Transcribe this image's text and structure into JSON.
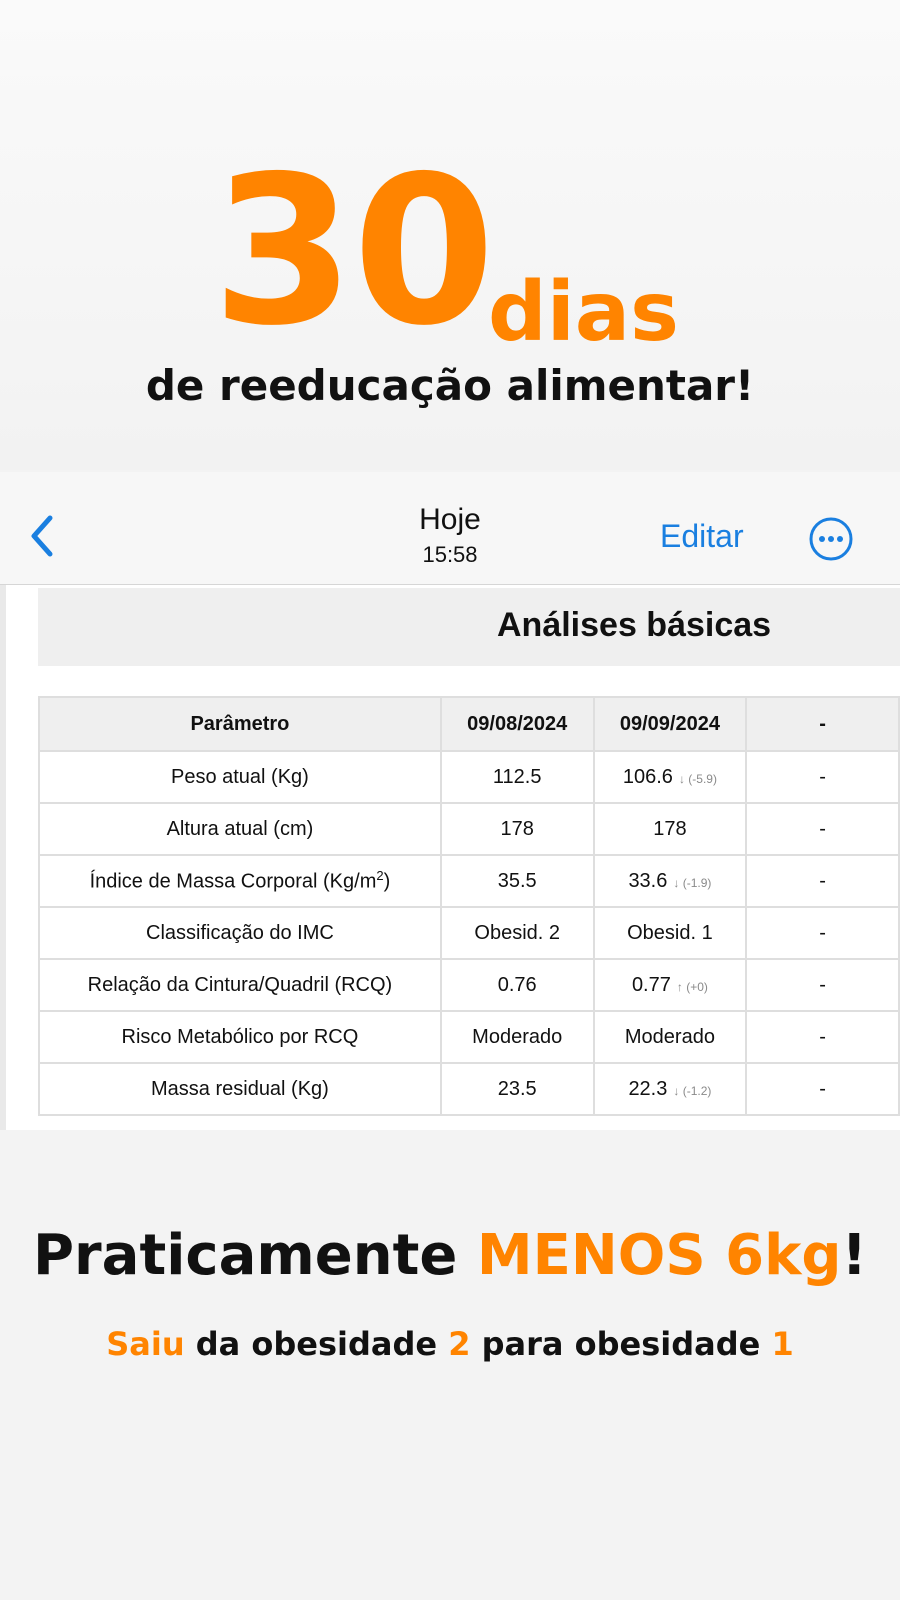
{
  "headline": {
    "number": "30",
    "unit": "dias",
    "subtitle": "de reeducação alimentar!"
  },
  "navbar": {
    "title": "Hoje",
    "time": "15:58",
    "edit_label": "Editar",
    "back_icon": "chevron-left-icon",
    "more_icon": "ellipsis-circle-icon"
  },
  "section": {
    "title": "Análises básicas"
  },
  "table": {
    "headers": [
      "Parâmetro",
      "09/08/2024",
      "09/09/2024",
      "-"
    ],
    "rows": [
      {
        "param": "Peso atual (Kg)",
        "v1": "112.5",
        "v2": "106.6",
        "d2": "↓ (-5.9)",
        "v3": "-"
      },
      {
        "param": "Altura atual (cm)",
        "v1": "178",
        "v2": "178",
        "d2": "",
        "v3": "-"
      },
      {
        "param": "Índice de Massa Corporal (Kg/m",
        "sup": "2",
        "param_end": ")",
        "v1": "35.5",
        "v2": "33.6",
        "d2": "↓ (-1.9)",
        "v3": "-"
      },
      {
        "param": "Classificação do IMC",
        "v1": "Obesid. 2",
        "v2": "Obesid. 1",
        "d2": "",
        "v3": "-"
      },
      {
        "param": "Relação da Cintura/Quadril (RCQ)",
        "v1": "0.76",
        "v2": "0.77",
        "d2": "↑ (+0)",
        "v3": "-"
      },
      {
        "param": "Risco Metabólico por RCQ",
        "v1": "Moderado",
        "v2": "Moderado",
        "d2": "",
        "v3": "-"
      },
      {
        "param": "Massa residual (Kg)",
        "v1": "23.5",
        "v2": "22.3",
        "d2": "↓ (-1.2)",
        "v3": "-"
      }
    ]
  },
  "footer": {
    "line1_a": "Praticamente ",
    "line1_b": "MENOS 6kg",
    "line1_c": "!",
    "line2_a": "Saiu",
    "line2_b": " da obesidade ",
    "line2_c": "2",
    "line2_d": " para obesidade ",
    "line2_e": "1"
  },
  "colors": {
    "accent": "#ff8400",
    "link": "#1a7fe0"
  }
}
